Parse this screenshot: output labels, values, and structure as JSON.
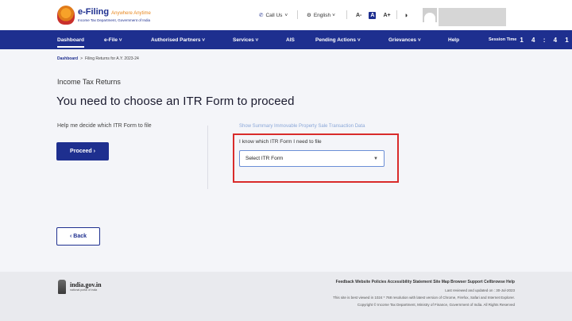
{
  "header": {
    "logo_title": "e-Filing",
    "logo_tagline": "Anywhere Anytime",
    "logo_subtitle": "Income Tax Department, Government of India",
    "call_us": "Call Us",
    "language": "English",
    "font_controls": [
      "A-",
      "A",
      "A+"
    ],
    "contrast_icon": "contrast-icon"
  },
  "nav": {
    "items": [
      {
        "label": "Dashboard"
      },
      {
        "label": "e-File ˅"
      },
      {
        "label": "Authorised Partners ˅"
      },
      {
        "label": "Services ˅"
      },
      {
        "label": "AIS"
      },
      {
        "label": "Pending Actions ˅"
      },
      {
        "label": "Grievances ˅"
      },
      {
        "label": "Help"
      }
    ],
    "session_label": "Session Time",
    "session_time": "1 4 : 4 1",
    "accent_color": "#1e2f8f"
  },
  "breadcrumb": {
    "home": "Dashboard",
    "separator": ">",
    "current": "Filing Returns for A.Y. 2023-24"
  },
  "main": {
    "section_label": "Income Tax Returns",
    "title": "You need to choose an ITR Form to proceed",
    "help_text": "Help me decide which ITR Form to file",
    "proceed_label": "Proceed  ›",
    "summary_link": "Show Summary Immovable Property Sale Transaction Data",
    "select_label": "I know which ITR Form I need to file",
    "select_value": "Select ITR Form",
    "back_label": "‹  Back"
  },
  "footer": {
    "gov_name": "india.gov.in",
    "gov_sub": "national portal of india",
    "links": "Feedback  Website Policies  Accessibility Statement  Site Map  Browser Support  Cellbrowse Help",
    "updated": "Last reviewed and updated on : 30-Jul-2023",
    "best_viewed": "This site is best viewed in 1024 * 768 resolution with latest version of Chrome, Firefox, Safari and Internet Explorer.",
    "copyright": "Copyright © Income Tax Department, Ministry of Finance, Government of India. All Rights Reserved"
  }
}
